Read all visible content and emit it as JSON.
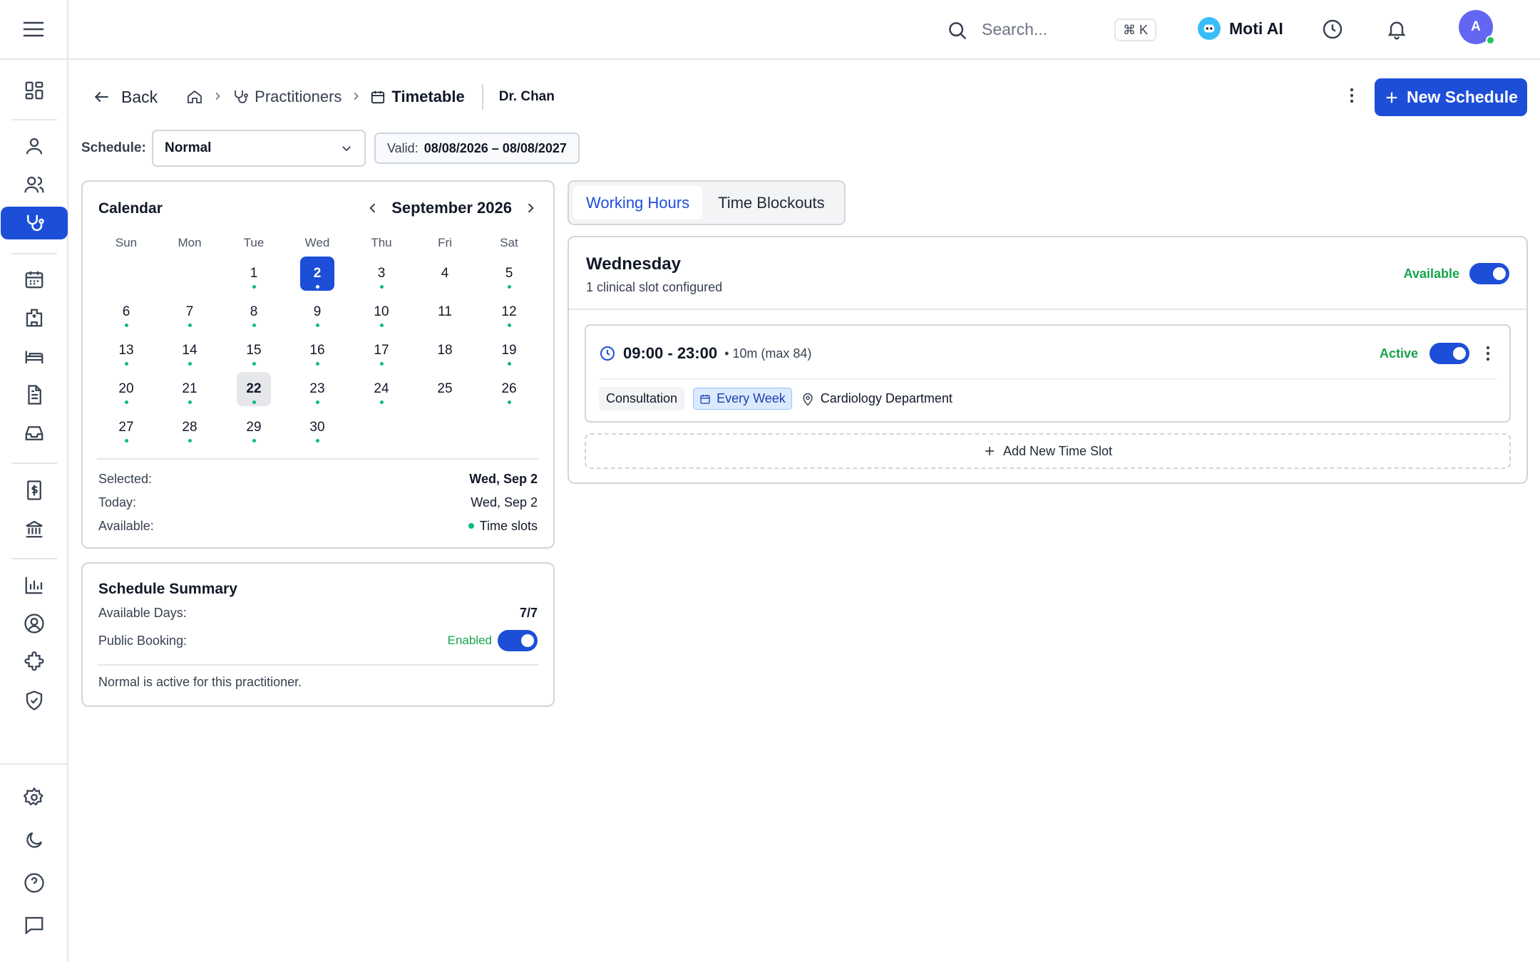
{
  "topbar": {
    "search_placeholder": "Search...",
    "shortcut": "⌘ K",
    "ai_label": "Moti AI",
    "avatar_initial": "A"
  },
  "breadcrumb": {
    "back": "Back",
    "practitioners": "Practitioners",
    "timetable": "Timetable",
    "doctor": "Dr. Chan"
  },
  "actions": {
    "new_schedule": "New Schedule"
  },
  "schedule": {
    "label": "Schedule:",
    "selected": "Normal",
    "valid_label": "Valid:",
    "valid_range": "08/08/2026 – 08/08/2027"
  },
  "calendar": {
    "title": "Calendar",
    "month": "September 2026",
    "weekdays": [
      "Sun",
      "Mon",
      "Tue",
      "Wed",
      "Thu",
      "Fri",
      "Sat"
    ],
    "days": [
      {
        "d": "1",
        "dot": true
      },
      {
        "d": "2",
        "dot": true,
        "selected": true
      },
      {
        "d": "3",
        "dot": true
      },
      {
        "d": "4",
        "dot": false
      },
      {
        "d": "5",
        "dot": true
      },
      {
        "d": "6",
        "dot": true
      },
      {
        "d": "7",
        "dot": true
      },
      {
        "d": "8",
        "dot": true
      },
      {
        "d": "9",
        "dot": true
      },
      {
        "d": "10",
        "dot": true
      },
      {
        "d": "11",
        "dot": false
      },
      {
        "d": "12",
        "dot": true
      },
      {
        "d": "13",
        "dot": true
      },
      {
        "d": "14",
        "dot": true
      },
      {
        "d": "15",
        "dot": true
      },
      {
        "d": "16",
        "dot": true
      },
      {
        "d": "17",
        "dot": true
      },
      {
        "d": "18",
        "dot": false
      },
      {
        "d": "19",
        "dot": true
      },
      {
        "d": "20",
        "dot": true
      },
      {
        "d": "21",
        "dot": true
      },
      {
        "d": "22",
        "dot": true,
        "today": true
      },
      {
        "d": "23",
        "dot": true
      },
      {
        "d": "24",
        "dot": true
      },
      {
        "d": "25",
        "dot": false
      },
      {
        "d": "26",
        "dot": true
      },
      {
        "d": "27",
        "dot": true
      },
      {
        "d": "28",
        "dot": true
      },
      {
        "d": "29",
        "dot": true
      },
      {
        "d": "30",
        "dot": true
      }
    ],
    "selected_label": "Selected:",
    "selected_value": "Wed, Sep 2",
    "today_label": "Today:",
    "today_value": "Wed, Sep 2",
    "available_label": "Available:",
    "available_value": "Time slots"
  },
  "summary": {
    "title": "Schedule Summary",
    "available_days_label": "Available Days:",
    "available_days_value": "7/7",
    "public_booking_label": "Public Booking:",
    "public_booking_status": "Enabled",
    "note": "Normal is active for this practitioner."
  },
  "tabs": {
    "working_hours": "Working Hours",
    "time_blockouts": "Time Blockouts"
  },
  "day_panel": {
    "day": "Wednesday",
    "subtitle": "1 clinical slot configured",
    "available_label": "Available",
    "slot": {
      "time": "09:00 - 23:00",
      "meta": "• 10m (max 84)",
      "status": "Active",
      "type": "Consultation",
      "recurrence": "Every Week",
      "location": "Cardiology Department"
    },
    "add_slot": "Add New Time Slot"
  },
  "colors": {
    "primary": "#1d4ed8",
    "success": "#16a34a",
    "dot": "#10b981"
  }
}
